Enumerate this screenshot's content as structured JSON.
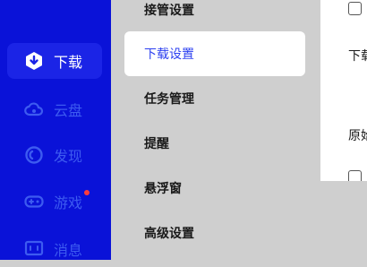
{
  "nav": {
    "items": [
      {
        "label": "下载",
        "icon": "download-icon",
        "active": true
      },
      {
        "label": "云盘",
        "icon": "cloud-icon",
        "active": false
      },
      {
        "label": "发现",
        "icon": "discover-icon",
        "active": false
      },
      {
        "label": "游戏",
        "icon": "gamepad-icon",
        "active": false,
        "badge": "red-dot"
      },
      {
        "label": "消息",
        "icon": "message-icon",
        "active": false
      }
    ]
  },
  "menu": {
    "items": [
      {
        "label": "接管设置",
        "active": false
      },
      {
        "label": "下载设置",
        "active": true
      },
      {
        "label": "任务管理",
        "active": false
      },
      {
        "label": "提醒",
        "active": false
      },
      {
        "label": "悬浮窗",
        "active": false
      },
      {
        "label": "高级设置",
        "active": false
      }
    ]
  },
  "panel": {
    "section_label": "下载",
    "option_label": "原始"
  },
  "colors": {
    "nav_bg": "#0a12d8",
    "accent": "#2b3ff0",
    "badge": "#ff3b3b"
  }
}
